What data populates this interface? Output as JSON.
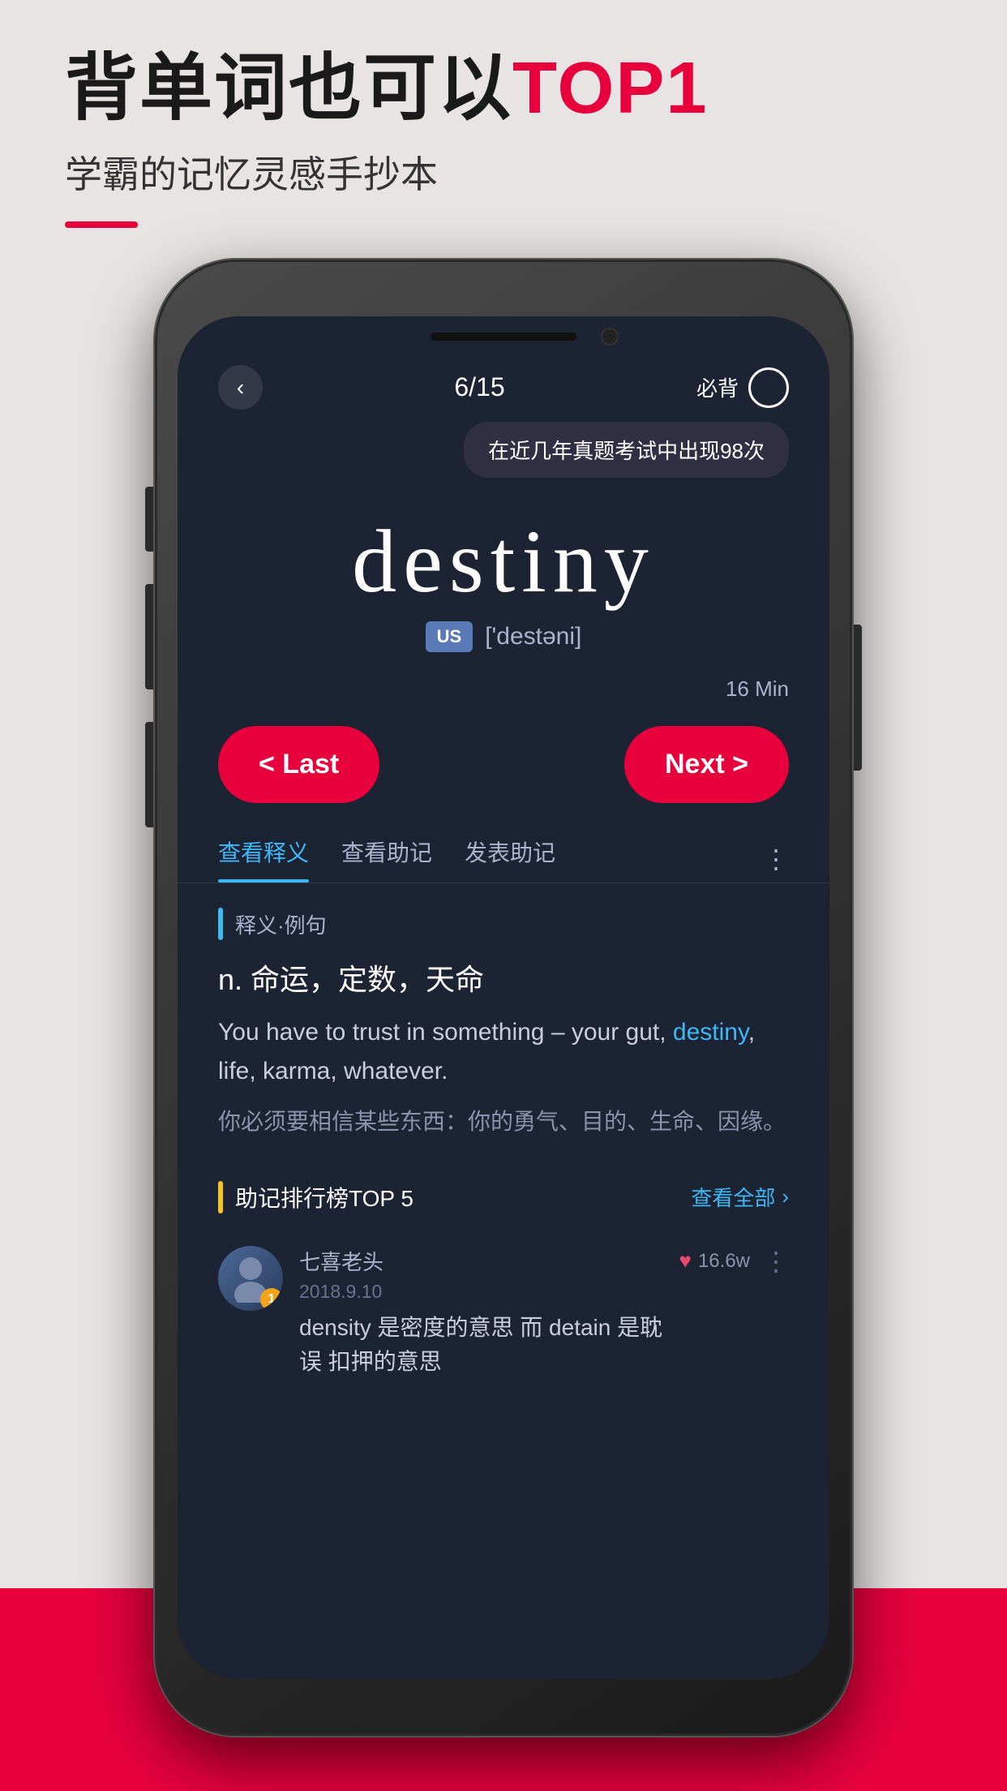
{
  "header": {
    "title_part1": "背单词也可以",
    "title_highlight": "TOP1",
    "subtitle": "学霸的记忆灵感手抄本",
    "underline": true
  },
  "phone": {
    "status": {
      "time": "",
      "signal": ""
    },
    "nav": {
      "back_icon": "‹",
      "counter": "6/15",
      "bookmark_label": "必背"
    },
    "tooltip": {
      "text": "在近几年真题考试中出现98次"
    },
    "word": {
      "text": "destiny",
      "phonetic_badge": "US",
      "phonetic": "['destəni]"
    },
    "time_label": "16 Min",
    "buttons": {
      "last": "< Last",
      "next": "Next >"
    },
    "tabs": [
      {
        "label": "查看释义",
        "active": true
      },
      {
        "label": "查看助记",
        "active": false
      },
      {
        "label": "发表助记",
        "active": false
      }
    ],
    "section_definition": {
      "label": "释义·例句",
      "pos": "n.  命运，定数，天命",
      "example_en_before": "You have to trust in something –\nyour gut, ",
      "example_en_word": "destiny",
      "example_en_after": ", life, karma, whatever.",
      "example_zh": "你必须要相信某些东西：你的勇气、目的、生命、因缘。"
    },
    "section_memory": {
      "label": "助记排行榜TOP 5",
      "view_all": "查看全部",
      "card": {
        "username": "七喜老头",
        "date": "2018.9.10",
        "avatar_badge": "1",
        "like_count": "16.6w",
        "content": "density 是密度的意思 而 detain 是耽误\n扣押的意思"
      }
    }
  }
}
